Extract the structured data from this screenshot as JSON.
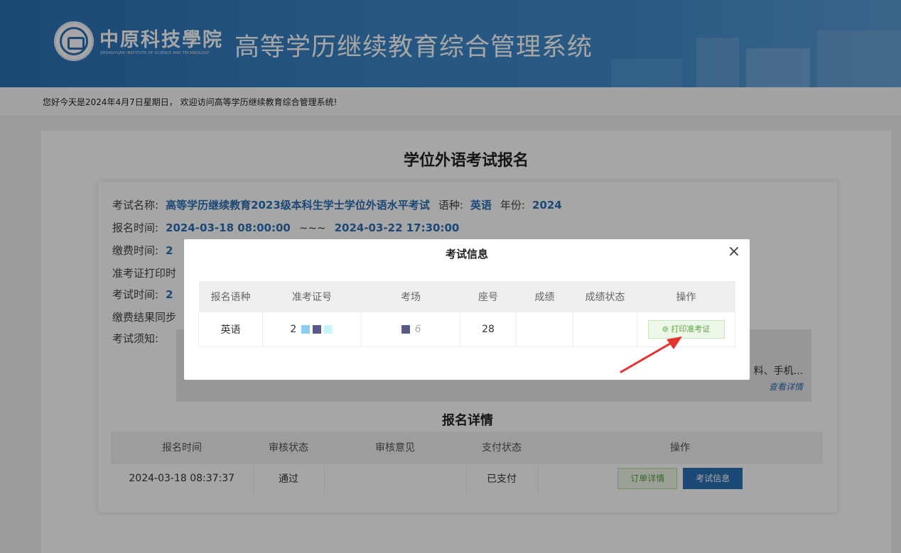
{
  "header": {
    "school_name": "中原科技學院",
    "school_name_en": "ZHONGYUAN INSTITUTE OF SCIENCE AND TECHNOLOGY",
    "system_title": "高等学历继续教育综合管理系统"
  },
  "greeting": "您好今天是2024年4月7日星期日， 欢迎访问高等学历继续教育综合管理系统!",
  "page": {
    "title": "学位外语考试报名",
    "exam_name_label": "考试名称:",
    "exam_name": "高等学历继续教育2023级本科生学士学位外语水平考试",
    "language_label": "语种:",
    "language": "英语",
    "year_label": "年份:",
    "year": "2024",
    "reg_time_label": "报名时间:",
    "reg_start": "2024-03-18 08:00:00",
    "reg_sep": "~~~",
    "reg_end": "2024-03-22 17:30:00",
    "pay_time_label": "缴费时间:",
    "pay_time_partial": "2",
    "print_time_label": "准考证打印时",
    "exam_time_label": "考试时间:",
    "exam_time_partial": "2",
    "pay_sync_label": "缴费结果同步",
    "notice_label": "考试须知:",
    "notice_text": "料、手机...",
    "notice_link": "查看详情"
  },
  "details": {
    "title": "报名详情",
    "headers": [
      "报名时间",
      "审核状态",
      "审核意见",
      "支付状态",
      "操作"
    ],
    "row": {
      "reg_time": "2024-03-18 08:37:37",
      "review_status": "通过",
      "review_opinion": "",
      "pay_status": "已支付",
      "order_button": "订单详情",
      "exam_info_button": "考试信息"
    }
  },
  "modal": {
    "title": "考试信息",
    "close": "×",
    "headers": [
      "报名语种",
      "准考证号",
      "考场",
      "座号",
      "成绩",
      "成绩状态",
      "操作"
    ],
    "row": {
      "language": "英语",
      "ticket_no": "2",
      "room": "6",
      "seat": "28",
      "score": "",
      "score_status": "",
      "print_button": "打印准考证"
    }
  },
  "colors": {
    "primary": "#2b6fb4",
    "success_text": "#5aa13e",
    "arrow": "#e3342f"
  },
  "icons": {
    "logo": "school-seal-icon",
    "print": "print-circle-icon",
    "arrow": "annotation-arrow-icon"
  }
}
